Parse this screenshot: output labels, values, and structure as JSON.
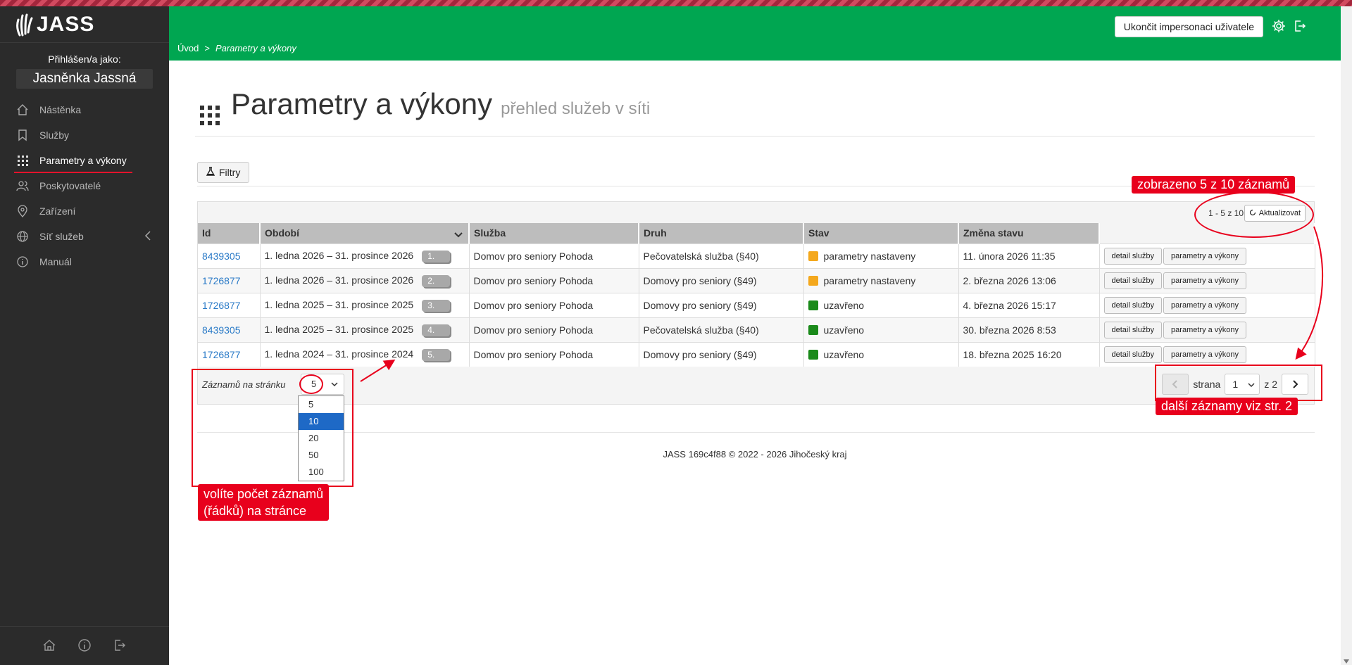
{
  "app": {
    "logo_text": "JASS"
  },
  "sidebar": {
    "logged_label": "Přihlášen/a jako:",
    "user_name": "Jasněnka Jassná",
    "items": [
      {
        "label": "Nástěnka",
        "icon": "home-icon"
      },
      {
        "label": "Služby",
        "icon": "bookmark-icon"
      },
      {
        "label": "Parametry a výkony",
        "icon": "grid-icon"
      },
      {
        "label": "Poskytovatelé",
        "icon": "users-icon"
      },
      {
        "label": "Zařízení",
        "icon": "map-pin-icon"
      },
      {
        "label": "Síť služeb",
        "icon": "globe-icon"
      },
      {
        "label": "Manuál",
        "icon": "info-icon"
      }
    ]
  },
  "header": {
    "impersonation_button": "Ukončit impersonaci uživatele",
    "breadcrumb": {
      "home": "Úvod",
      "separator": ">",
      "current": "Parametry a výkony"
    }
  },
  "page": {
    "title": "Parametry a výkony",
    "subtitle": "přehled služeb v síti",
    "filter_button": "Filtry",
    "range_text": "1 - 5 z 10",
    "refresh_button": "Aktualizovat"
  },
  "table": {
    "columns": [
      "Id",
      "Období",
      "Služba",
      "Druh",
      "Stav",
      "Změna stavu"
    ],
    "rows": [
      {
        "id": "8439305",
        "period": "1. ledna 2026 – 31. prosince 2026",
        "badge": "1.",
        "service": "Domov pro seniory Pohoda",
        "kind": "Pečovatelská služba (§40)",
        "status": "parametry nastaveny",
        "status_color": "#f4a81d",
        "changed": "11. února 2026 11:35"
      },
      {
        "id": "1726877",
        "period": "1. ledna 2026 – 31. prosince 2026",
        "badge": "2.",
        "service": "Domov pro seniory Pohoda",
        "kind": "Domovy pro seniory (§49)",
        "status": "parametry nastaveny",
        "status_color": "#f4a81d",
        "changed": "2. března 2026 13:06"
      },
      {
        "id": "1726877",
        "period": "1. ledna 2025 – 31. prosince 2025",
        "badge": "3.",
        "service": "Domov pro seniory Pohoda",
        "kind": "Domovy pro seniory (§49)",
        "status": "uzavřeno",
        "status_color": "#1a8a1a",
        "changed": "4. března 2026 15:17"
      },
      {
        "id": "8439305",
        "period": "1. ledna 2025 – 31. prosince 2025",
        "badge": "4.",
        "service": "Domov pro seniory Pohoda",
        "kind": "Pečovatelská služba (§40)",
        "status": "uzavřeno",
        "status_color": "#1a8a1a",
        "changed": "30. března 2026 8:53"
      },
      {
        "id": "1726877",
        "period": "1. ledna 2024 – 31. prosince 2024",
        "badge": "5.",
        "service": "Domov pro seniory Pohoda",
        "kind": "Domovy pro seniory (§49)",
        "status": "uzavřeno",
        "status_color": "#1a8a1a",
        "changed": "18. března 2025 16:20"
      }
    ],
    "row_buttons": {
      "detail": "detail služby",
      "params": "parametry a výkony"
    }
  },
  "pagination": {
    "per_page_label": "Záznamů na stránku",
    "per_page_value": "5",
    "per_page_options": [
      "5",
      "10",
      "20",
      "50",
      "100"
    ],
    "page_label": "strana",
    "page_value": "1",
    "of_pages": "z 2"
  },
  "footer": {
    "text": "JASS 169c4f88 © 2022 - 2026 Jihočeský kraj"
  },
  "annotations": {
    "records_shown": "zobrazeno 5 z 10 záznamů",
    "next_records": "další záznamy viz str. 2",
    "choose_rows_line1": "volíte počet záznamů",
    "choose_rows_line2": "(řádků) na stránce"
  },
  "colors": {
    "header_green": "#00a651",
    "sidebar_bg": "#2b2b2b",
    "accent_red": "#e8001c",
    "link_blue": "#2a7ac7"
  }
}
